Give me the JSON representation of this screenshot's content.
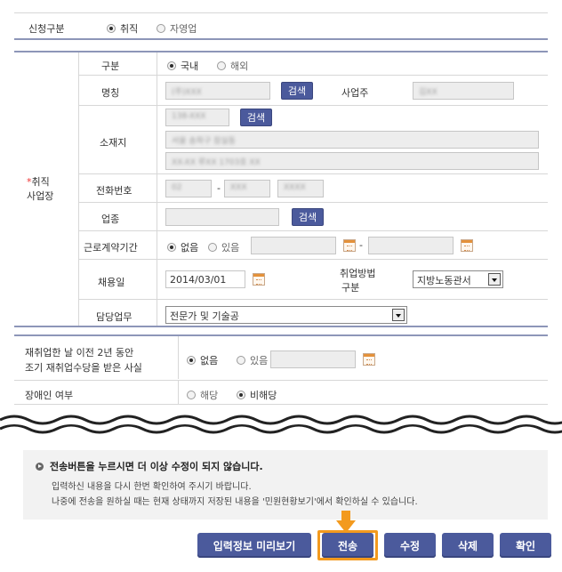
{
  "application_type": {
    "label": "신청구분",
    "options": [
      {
        "label": "취직",
        "selected": true
      },
      {
        "label": "자영업",
        "selected": false
      }
    ]
  },
  "workplace": {
    "section_label_line1": "취직",
    "section_label_line2": "사업장",
    "required_mark": "*",
    "category": {
      "label": "구분",
      "options": [
        {
          "label": "국내",
          "selected": true
        },
        {
          "label": "해외",
          "selected": false
        }
      ]
    },
    "name": {
      "label": "명칭",
      "value": "(주)XXX",
      "search_label": "검색"
    },
    "business_owner": {
      "label": "사업주",
      "value": "김XX"
    },
    "address": {
      "label": "소재지",
      "zip_value": "138-XXX",
      "search_label": "검색",
      "line1_value": "서울 송파구 잠실동",
      "line2_value": "XX-XX 루XX 1703호 XX"
    },
    "phone": {
      "label": "전화번호",
      "part1": "02",
      "part2": "XXX",
      "part3": "XXXX",
      "separator": "-"
    },
    "industry": {
      "label": "업종",
      "value": "",
      "search_label": "검색"
    },
    "contract_period": {
      "label": "근로계약기간",
      "options": [
        {
          "label": "없음",
          "selected": true
        },
        {
          "label": "있음",
          "selected": false
        }
      ],
      "separator": "-"
    },
    "hire_date": {
      "label": "채용일",
      "value": "2014/03/01"
    },
    "employment_method": {
      "label_line1": "취업방법",
      "label_line2": "구분",
      "selected": "지방노동관서"
    },
    "duty": {
      "label": "담당업무",
      "selected": "전문가 및 기술공"
    }
  },
  "re_employment": {
    "label_line1": "재취업한 날 이전 2년 동안",
    "label_line2": "조기 재취업수당을 받은 사실",
    "options": [
      {
        "label": "없음",
        "selected": true
      },
      {
        "label": "있음",
        "selected": false
      }
    ]
  },
  "disability": {
    "label": "장애인 여부",
    "options": [
      {
        "label": "해당",
        "selected": false
      },
      {
        "label": "비해당",
        "selected": true
      }
    ]
  },
  "notice": {
    "title": "전송버튼을 누르시면 더 이상 수정이 되지 않습니다.",
    "line1": "입력하신 내용을 다시 한번 확인하여 주시기 바랍니다.",
    "line2": "나중에 전송을 원하실 때는 현재 상태까지 저장된 내용을 '민원현황보기'에서 확인하실 수 있습니다."
  },
  "actions": {
    "preview_label": "입력정보 미리보기",
    "submit_label": "전송",
    "edit_label": "수정",
    "delete_label": "삭제",
    "confirm_label": "확인"
  },
  "colors": {
    "button_blue": "#4b5a9c",
    "highlight_orange": "#f39a1e",
    "required_red": "#e33333",
    "notice_bg": "#f2f2f2"
  }
}
